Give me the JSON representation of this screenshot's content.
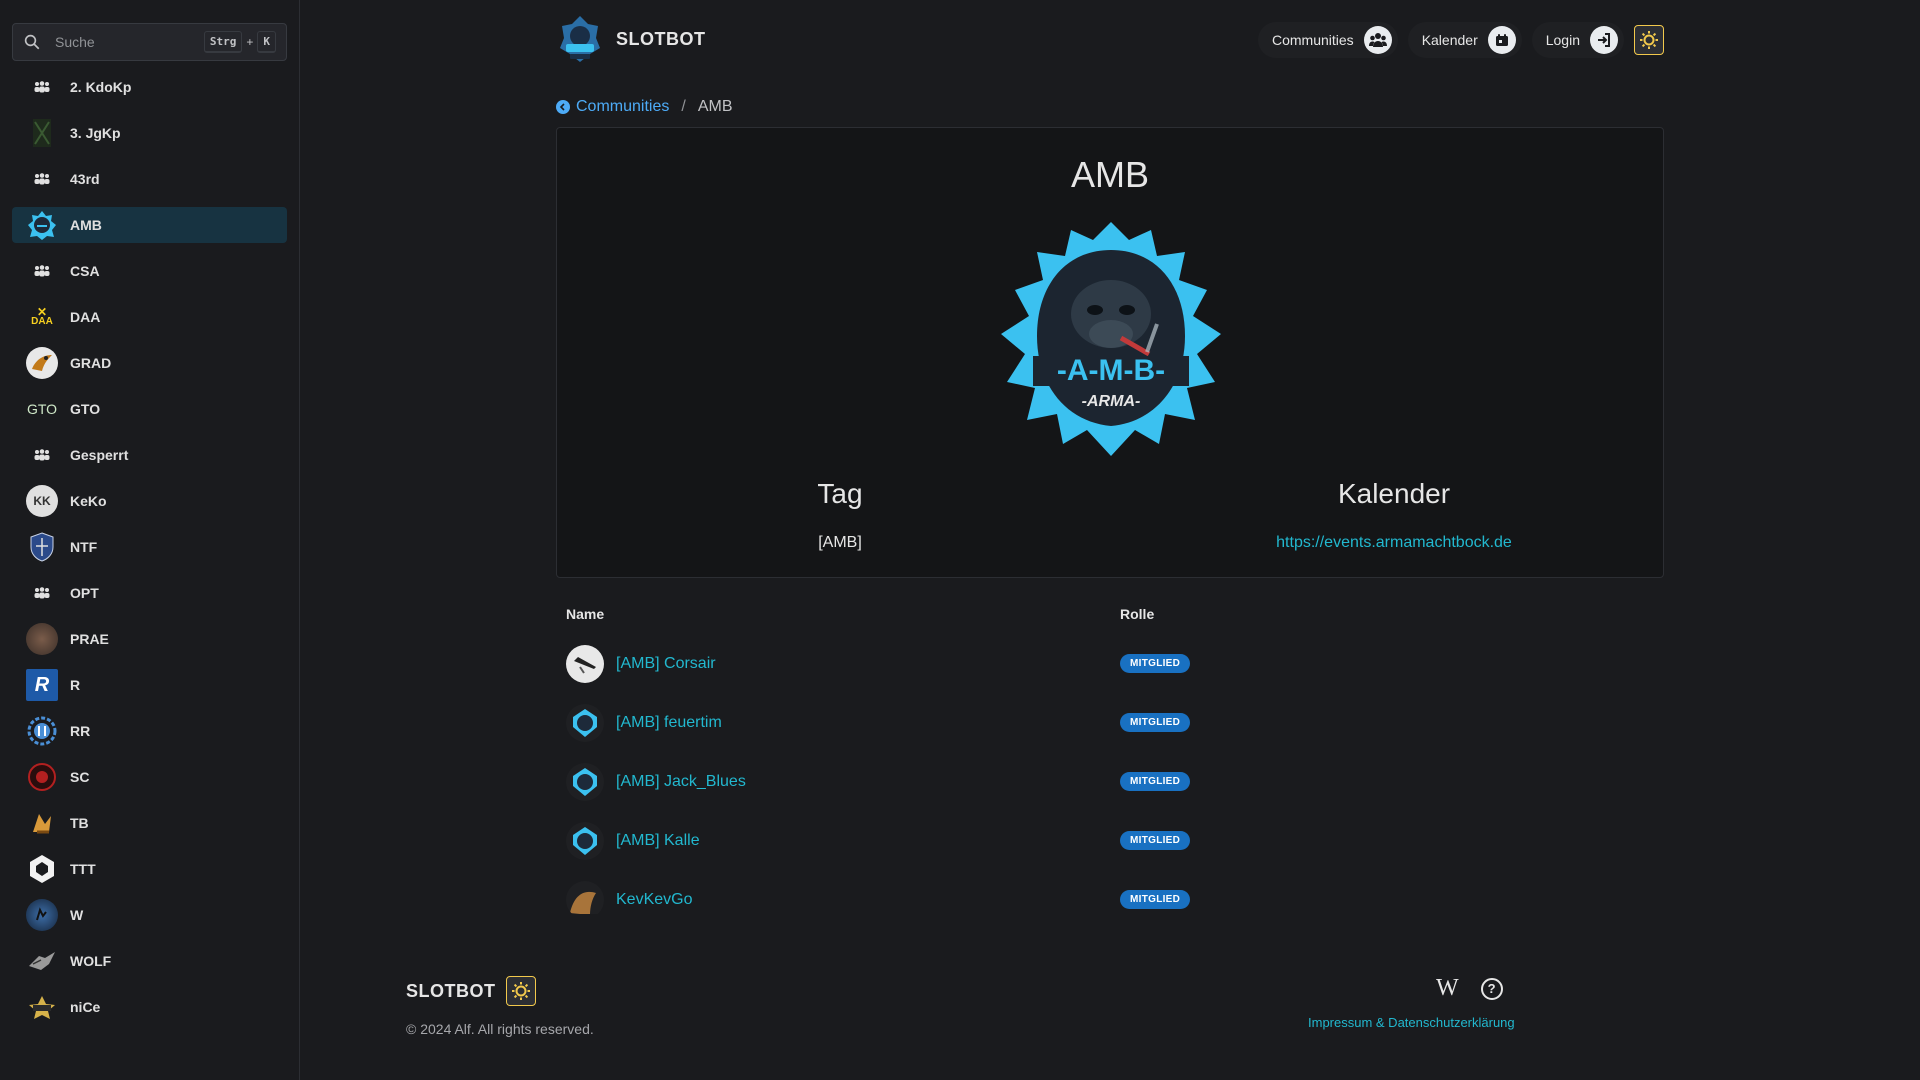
{
  "search": {
    "placeholder": "Suche",
    "kbd_mod": "Strg",
    "kbd_plus": "+",
    "kbd_key": "K"
  },
  "sidebar": {
    "items": [
      {
        "label": "2. KdoKp",
        "icon": "group-icon"
      },
      {
        "label": "3. JgKp",
        "icon": "community-logo-icon"
      },
      {
        "label": "43rd",
        "icon": "group-icon"
      },
      {
        "label": "AMB",
        "icon": "community-logo-icon"
      },
      {
        "label": "CSA",
        "icon": "group-icon"
      },
      {
        "label": "DAA",
        "icon": "community-logo-icon"
      },
      {
        "label": "GRAD",
        "icon": "community-logo-icon"
      },
      {
        "label": "GTO",
        "icon": "community-logo-icon"
      },
      {
        "label": "Gesperrt",
        "icon": "group-icon"
      },
      {
        "label": "KeKo",
        "icon": "community-logo-icon"
      },
      {
        "label": "NTF",
        "icon": "community-logo-icon"
      },
      {
        "label": "OPT",
        "icon": "group-icon"
      },
      {
        "label": "PRAE",
        "icon": "community-logo-icon"
      },
      {
        "label": "R",
        "icon": "community-logo-icon"
      },
      {
        "label": "RR",
        "icon": "community-logo-icon"
      },
      {
        "label": "SC",
        "icon": "community-logo-icon"
      },
      {
        "label": "TB",
        "icon": "community-logo-icon"
      },
      {
        "label": "TTT",
        "icon": "community-logo-icon"
      },
      {
        "label": "W",
        "icon": "community-logo-icon"
      },
      {
        "label": "WOLF",
        "icon": "community-logo-icon"
      },
      {
        "label": "niCe",
        "icon": "community-logo-icon"
      }
    ],
    "active": "AMB",
    "logo_text": {
      "gto": "GTO",
      "r": "R",
      "daa": "DAA",
      "keko": "KK"
    }
  },
  "header": {
    "brand": "SLOTBOT",
    "communities": "Communities",
    "calendar": "Kalender",
    "login": "Login"
  },
  "breadcrumb": {
    "parent": "Communities",
    "separator": "/",
    "current": "AMB"
  },
  "community": {
    "name": "AMB",
    "logo_text": "-A-M-B-",
    "logo_subtext": "-ARMA-",
    "tag_label": "Tag",
    "tag_value": "[AMB]",
    "calendar_label": "Kalender",
    "calendar_url": "https://events.armamachtbock.de"
  },
  "members": {
    "col_name": "Name",
    "col_role": "Rolle",
    "rows": [
      {
        "name": "[AMB] Corsair",
        "role": "MITGLIED"
      },
      {
        "name": "[AMB] feuertim",
        "role": "MITGLIED"
      },
      {
        "name": "[AMB] Jack_Blues",
        "role": "MITGLIED"
      },
      {
        "name": "[AMB] Kalle",
        "role": "MITGLIED"
      },
      {
        "name": "KevKevGo",
        "role": "MITGLIED"
      }
    ]
  },
  "footer": {
    "brand": "SLOTBOT",
    "copyright": "© 2024 Alf. All rights reserved.",
    "wiki_glyph": "W",
    "help_glyph": "?",
    "legal": "Impressum & Datenschutzerklärung"
  },
  "colors": {
    "accent": "#22b8cf",
    "link": "#4dabf7",
    "active_bg": "#173341",
    "badge": "#1971c2",
    "theme_yellow": "#f2c94c"
  }
}
